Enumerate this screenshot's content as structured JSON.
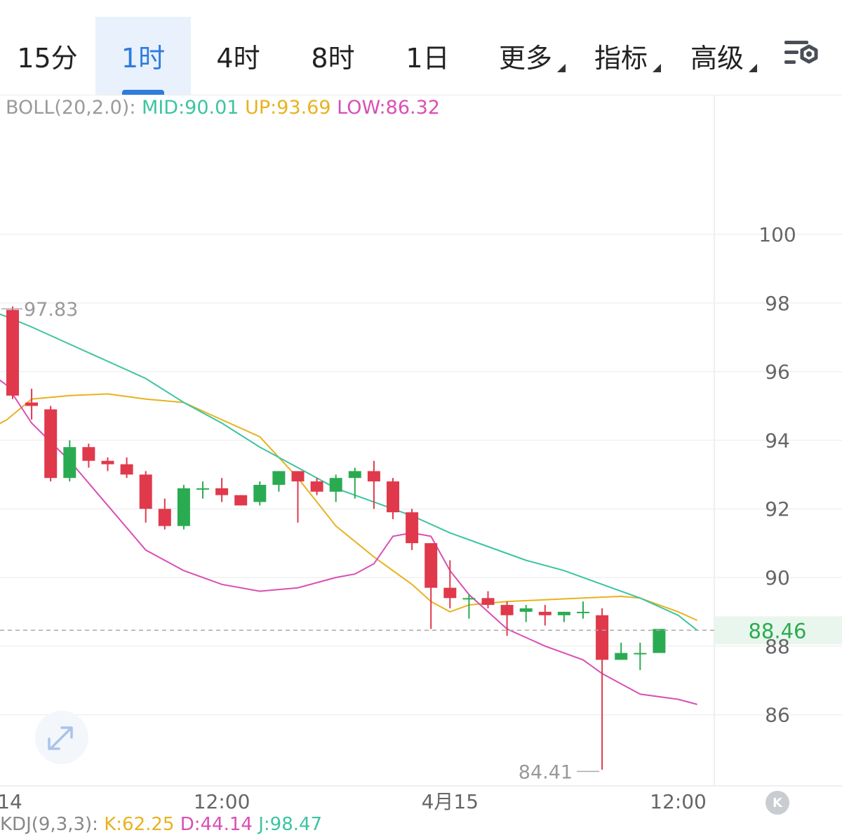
{
  "tabs": [
    {
      "label": "15分",
      "active": false,
      "dropdown": false
    },
    {
      "label": "1时",
      "active": true,
      "dropdown": false
    },
    {
      "label": "4时",
      "active": false,
      "dropdown": false
    },
    {
      "label": "8时",
      "active": false,
      "dropdown": false
    },
    {
      "label": "1日",
      "active": false,
      "dropdown": false
    },
    {
      "label": "更多",
      "active": false,
      "dropdown": true
    },
    {
      "label": "指标",
      "active": false,
      "dropdown": true
    },
    {
      "label": "高级",
      "active": false,
      "dropdown": true
    }
  ],
  "settings_icon": "chart-settings-icon",
  "boll": {
    "label": "BOLL(20,2.0):",
    "mid": "MID:90.01",
    "up": "UP:93.69",
    "low": "LOW:86.32",
    "colors": {
      "label": "#9a9a9a",
      "mid": "#3cc4a0",
      "up": "#e8b21e",
      "low": "#d94fb5"
    }
  },
  "kdj_legend": {
    "label": "KDJ(9,3,3):",
    "k": "K:62.25",
    "d": "D:44.14",
    "j": "J:98.47"
  },
  "current_price": "88.46",
  "high_marker": "97.83",
  "low_marker": "84.41",
  "colors": {
    "up": "#2bab51",
    "down": "#e0394c",
    "price_line": "#aaaaaa",
    "price_badge": "#2bab51"
  },
  "chart_data": {
    "type": "candlestick",
    "y_ticks": [
      "100",
      "98",
      "96",
      "94",
      "92",
      "90",
      "88",
      "86"
    ],
    "y_range": [
      84.1,
      100.6
    ],
    "x_ticks": [
      {
        "label": "14",
        "index": -0.5
      },
      {
        "label": "12:00",
        "index": 11
      },
      {
        "label": "4月15",
        "index": 23
      },
      {
        "label": "12:00",
        "index": 35
      }
    ],
    "candles": [
      {
        "o": 97.8,
        "h": 97.9,
        "l": 95.2,
        "c": 95.3
      },
      {
        "o": 95.1,
        "h": 95.5,
        "l": 94.6,
        "c": 95.0
      },
      {
        "o": 94.9,
        "h": 95.0,
        "l": 92.8,
        "c": 92.9
      },
      {
        "o": 92.9,
        "h": 94.0,
        "l": 92.8,
        "c": 93.8
      },
      {
        "o": 93.8,
        "h": 93.9,
        "l": 93.2,
        "c": 93.4
      },
      {
        "o": 93.4,
        "h": 93.5,
        "l": 93.1,
        "c": 93.3
      },
      {
        "o": 93.3,
        "h": 93.5,
        "l": 92.9,
        "c": 93.0
      },
      {
        "o": 93.0,
        "h": 93.1,
        "l": 91.6,
        "c": 92.0
      },
      {
        "o": 92.0,
        "h": 92.3,
        "l": 91.4,
        "c": 91.5
      },
      {
        "o": 91.5,
        "h": 92.7,
        "l": 91.4,
        "c": 92.6
      },
      {
        "o": 92.6,
        "h": 92.8,
        "l": 92.3,
        "c": 92.6
      },
      {
        "o": 92.6,
        "h": 92.9,
        "l": 92.2,
        "c": 92.4
      },
      {
        "o": 92.4,
        "h": 92.4,
        "l": 92.1,
        "c": 92.1
      },
      {
        "o": 92.2,
        "h": 92.8,
        "l": 92.1,
        "c": 92.7
      },
      {
        "o": 92.7,
        "h": 93.1,
        "l": 92.5,
        "c": 93.1
      },
      {
        "o": 93.1,
        "h": 93.1,
        "l": 91.6,
        "c": 92.8
      },
      {
        "o": 92.8,
        "h": 92.9,
        "l": 92.4,
        "c": 92.5
      },
      {
        "o": 92.5,
        "h": 93.0,
        "l": 92.2,
        "c": 92.9
      },
      {
        "o": 92.9,
        "h": 93.2,
        "l": 92.3,
        "c": 93.1
      },
      {
        "o": 93.1,
        "h": 93.4,
        "l": 92.0,
        "c": 92.8
      },
      {
        "o": 92.8,
        "h": 92.9,
        "l": 91.7,
        "c": 91.9
      },
      {
        "o": 91.9,
        "h": 92.0,
        "l": 90.8,
        "c": 91.0
      },
      {
        "o": 91.0,
        "h": 91.0,
        "l": 88.5,
        "c": 89.7
      },
      {
        "o": 89.7,
        "h": 90.5,
        "l": 89.1,
        "c": 89.4
      },
      {
        "o": 89.4,
        "h": 89.5,
        "l": 88.8,
        "c": 89.4
      },
      {
        "o": 89.4,
        "h": 89.6,
        "l": 89.1,
        "c": 89.2
      },
      {
        "o": 89.2,
        "h": 89.3,
        "l": 88.3,
        "c": 88.9
      },
      {
        "o": 89.0,
        "h": 89.2,
        "l": 88.7,
        "c": 89.1
      },
      {
        "o": 89.0,
        "h": 89.2,
        "l": 88.6,
        "c": 88.9
      },
      {
        "o": 88.9,
        "h": 89.0,
        "l": 88.7,
        "c": 89.0
      },
      {
        "o": 89.0,
        "h": 89.3,
        "l": 88.8,
        "c": 89.0
      },
      {
        "o": 88.9,
        "h": 89.1,
        "l": 84.4,
        "c": 87.6
      },
      {
        "o": 87.6,
        "h": 88.1,
        "l": 87.6,
        "c": 87.8
      },
      {
        "o": 87.8,
        "h": 88.1,
        "l": 87.3,
        "c": 87.8
      },
      {
        "o": 87.8,
        "h": 88.5,
        "l": 87.8,
        "c": 88.5
      }
    ],
    "boll_up": [
      [
        -1.3,
        94.3
      ],
      [
        -0.3,
        94.6
      ],
      [
        1,
        95.2
      ],
      [
        3,
        95.3
      ],
      [
        5,
        95.35
      ],
      [
        7,
        95.2
      ],
      [
        9,
        95.1
      ],
      [
        11,
        94.6
      ],
      [
        13,
        94.1
      ],
      [
        15,
        92.9
      ],
      [
        17,
        91.5
      ],
      [
        19,
        90.6
      ],
      [
        21,
        89.8
      ],
      [
        22,
        89.3
      ],
      [
        23,
        89.0
      ],
      [
        24,
        89.2
      ],
      [
        26,
        89.3
      ],
      [
        28,
        89.35
      ],
      [
        30,
        89.4
      ],
      [
        32,
        89.45
      ],
      [
        33,
        89.4
      ],
      [
        35,
        89.0
      ],
      [
        36,
        88.75
      ]
    ],
    "boll_mid": [
      [
        -1.3,
        97.8
      ],
      [
        -0.3,
        97.6
      ],
      [
        1,
        97.3
      ],
      [
        3,
        96.8
      ],
      [
        5,
        96.3
      ],
      [
        7,
        95.8
      ],
      [
        9,
        95.1
      ],
      [
        11,
        94.5
      ],
      [
        13,
        93.8
      ],
      [
        15,
        93.2
      ],
      [
        17,
        92.6
      ],
      [
        19,
        92.2
      ],
      [
        21,
        91.8
      ],
      [
        23,
        91.3
      ],
      [
        25,
        90.9
      ],
      [
        27,
        90.5
      ],
      [
        29,
        90.2
      ],
      [
        31,
        89.8
      ],
      [
        33,
        89.4
      ],
      [
        35,
        88.9
      ],
      [
        36,
        88.46
      ]
    ],
    "boll_low": [
      [
        -1.3,
        96.0
      ],
      [
        -0.3,
        95.6
      ],
      [
        1,
        94.5
      ],
      [
        3,
        93.4
      ],
      [
        5,
        92.1
      ],
      [
        7,
        90.8
      ],
      [
        9,
        90.2
      ],
      [
        11,
        89.8
      ],
      [
        13,
        89.6
      ],
      [
        15,
        89.7
      ],
      [
        17,
        90.0
      ],
      [
        18,
        90.1
      ],
      [
        19,
        90.4
      ],
      [
        20,
        91.2
      ],
      [
        21,
        91.3
      ],
      [
        22,
        91.2
      ],
      [
        23,
        90.2
      ],
      [
        24,
        89.5
      ],
      [
        26,
        88.5
      ],
      [
        28,
        88.0
      ],
      [
        30,
        87.6
      ],
      [
        31,
        87.2
      ],
      [
        32,
        86.9
      ],
      [
        33,
        86.6
      ],
      [
        35,
        86.45
      ],
      [
        36,
        86.3
      ]
    ]
  }
}
